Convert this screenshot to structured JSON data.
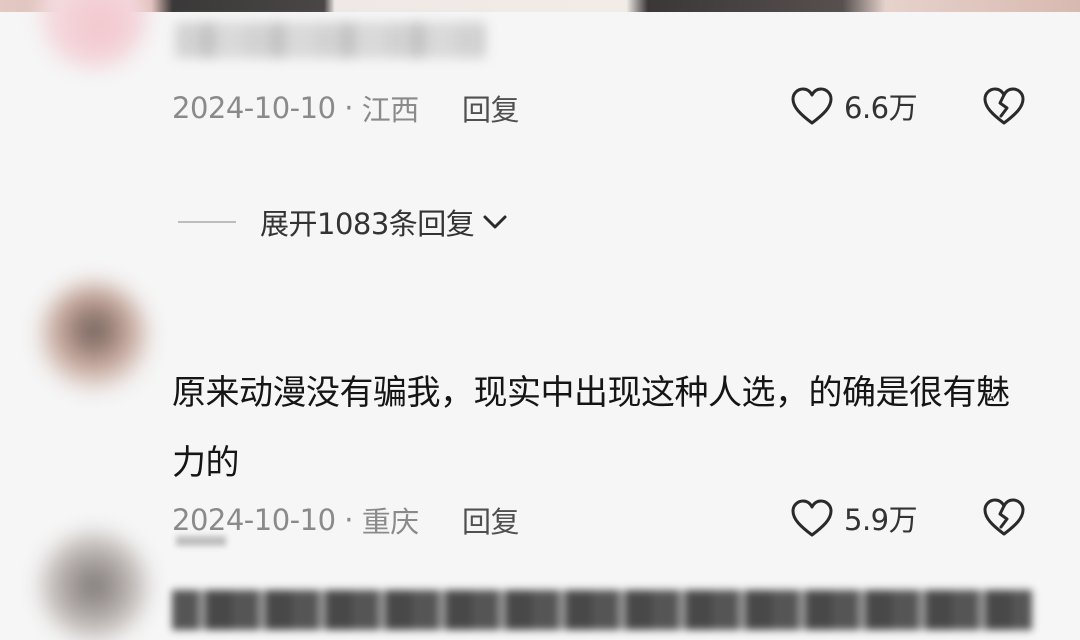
{
  "comments": [
    {
      "date": "2024-10-10",
      "location": "江西",
      "reply_label": "回复",
      "likes": "6.6万"
    },
    {
      "text": "原来动漫没有骗我，现实中出现这种人选，的确是很有魅力的",
      "date": "2024-10-10",
      "location": "重庆",
      "reply_label": "回复",
      "likes": "5.9万"
    }
  ],
  "expand_replies_label": "展开1083条回复",
  "icons": {
    "like": "heart-outline-icon",
    "dislike": "broken-heart-icon",
    "expand": "chevron-down-icon"
  },
  "colors": {
    "background": "#f6f6f6",
    "meta_text": "#8a8a8a",
    "body_text": "#151515"
  }
}
